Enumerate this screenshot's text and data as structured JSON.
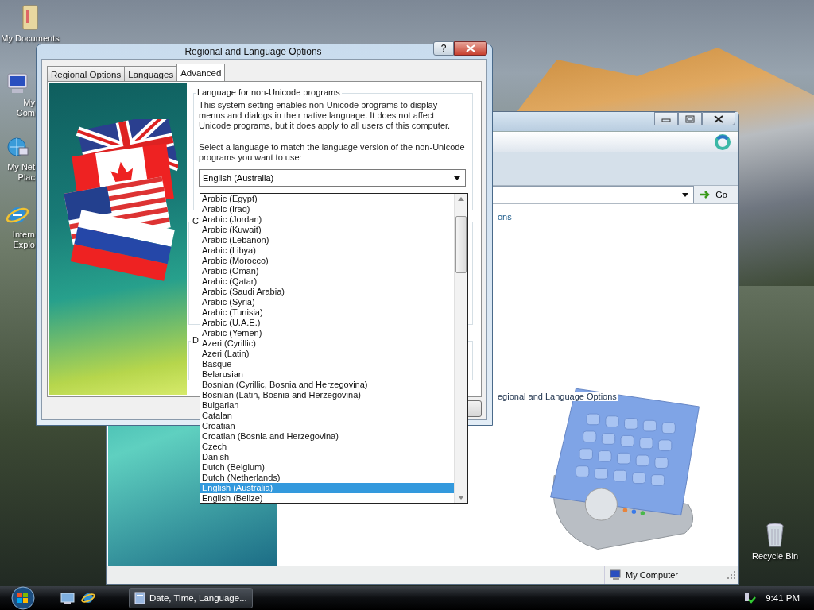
{
  "desktop_icons": [
    {
      "kind": "folder",
      "label": "My Documents"
    },
    {
      "kind": "computer",
      "label": "My Com"
    },
    {
      "kind": "network",
      "label": "My Net Plac"
    },
    {
      "kind": "browser",
      "label": "Intern Explo"
    },
    {
      "kind": "trash",
      "label": "Recycle Bin"
    }
  ],
  "background_window": {
    "go_button": "Go",
    "link_text": "ons",
    "item_label": "egional and Language Options",
    "status_bar": {
      "location": "My Computer"
    }
  },
  "dialog": {
    "title": "Regional and Language Options",
    "help_button": "?",
    "tabs": [
      {
        "label": "Regional Options",
        "selected": false
      },
      {
        "label": "Languages",
        "selected": false
      },
      {
        "label": "Advanced",
        "selected": true
      }
    ],
    "language_group": {
      "title": "Language for non-Unicode programs",
      "description": "This system setting enables non-Unicode programs to display menus and dialogs in their native language. It does not affect Unicode programs, but it does apply to all users of this computer.",
      "prompt": "Select a language to match the language version of the non-Unicode programs you want to use:",
      "dropdown": {
        "value": "English (Australia)",
        "expanded": true,
        "options": [
          {
            "label": "Arabic (Egypt)",
            "selected": false
          },
          {
            "label": "Arabic (Iraq)",
            "selected": false
          },
          {
            "label": "Arabic (Jordan)",
            "selected": false
          },
          {
            "label": "Arabic (Kuwait)",
            "selected": false
          },
          {
            "label": "Arabic (Lebanon)",
            "selected": false
          },
          {
            "label": "Arabic (Libya)",
            "selected": false
          },
          {
            "label": "Arabic (Morocco)",
            "selected": false
          },
          {
            "label": "Arabic (Oman)",
            "selected": false
          },
          {
            "label": "Arabic (Qatar)",
            "selected": false
          },
          {
            "label": "Arabic (Saudi Arabia)",
            "selected": false
          },
          {
            "label": "Arabic (Syria)",
            "selected": false
          },
          {
            "label": "Arabic (Tunisia)",
            "selected": false
          },
          {
            "label": "Arabic (U.A.E.)",
            "selected": false
          },
          {
            "label": "Arabic (Yemen)",
            "selected": false
          },
          {
            "label": "Azeri (Cyrillic)",
            "selected": false
          },
          {
            "label": "Azeri (Latin)",
            "selected": false
          },
          {
            "label": "Basque",
            "selected": false
          },
          {
            "label": "Belarusian",
            "selected": false
          },
          {
            "label": "Bosnian (Cyrillic, Bosnia and Herzegovina)",
            "selected": false
          },
          {
            "label": "Bosnian (Latin, Bosnia and Herzegovina)",
            "selected": false
          },
          {
            "label": "Bulgarian",
            "selected": false
          },
          {
            "label": "Catalan",
            "selected": false
          },
          {
            "label": "Croatian",
            "selected": false
          },
          {
            "label": "Croatian (Bosnia and Herzegovina)",
            "selected": false
          },
          {
            "label": "Czech",
            "selected": false
          },
          {
            "label": "Danish",
            "selected": false
          },
          {
            "label": "Dutch (Belgium)",
            "selected": false
          },
          {
            "label": "Dutch (Netherlands)",
            "selected": false
          },
          {
            "label": "English (Australia)",
            "selected": true
          },
          {
            "label": "English (Belize)",
            "selected": false
          }
        ]
      }
    },
    "group_titles": [
      "C",
      "D"
    ]
  },
  "taskbar": {
    "tasks": [
      {
        "label": "Date, Time, Language..."
      }
    ],
    "clock": "9:41 PM"
  }
}
